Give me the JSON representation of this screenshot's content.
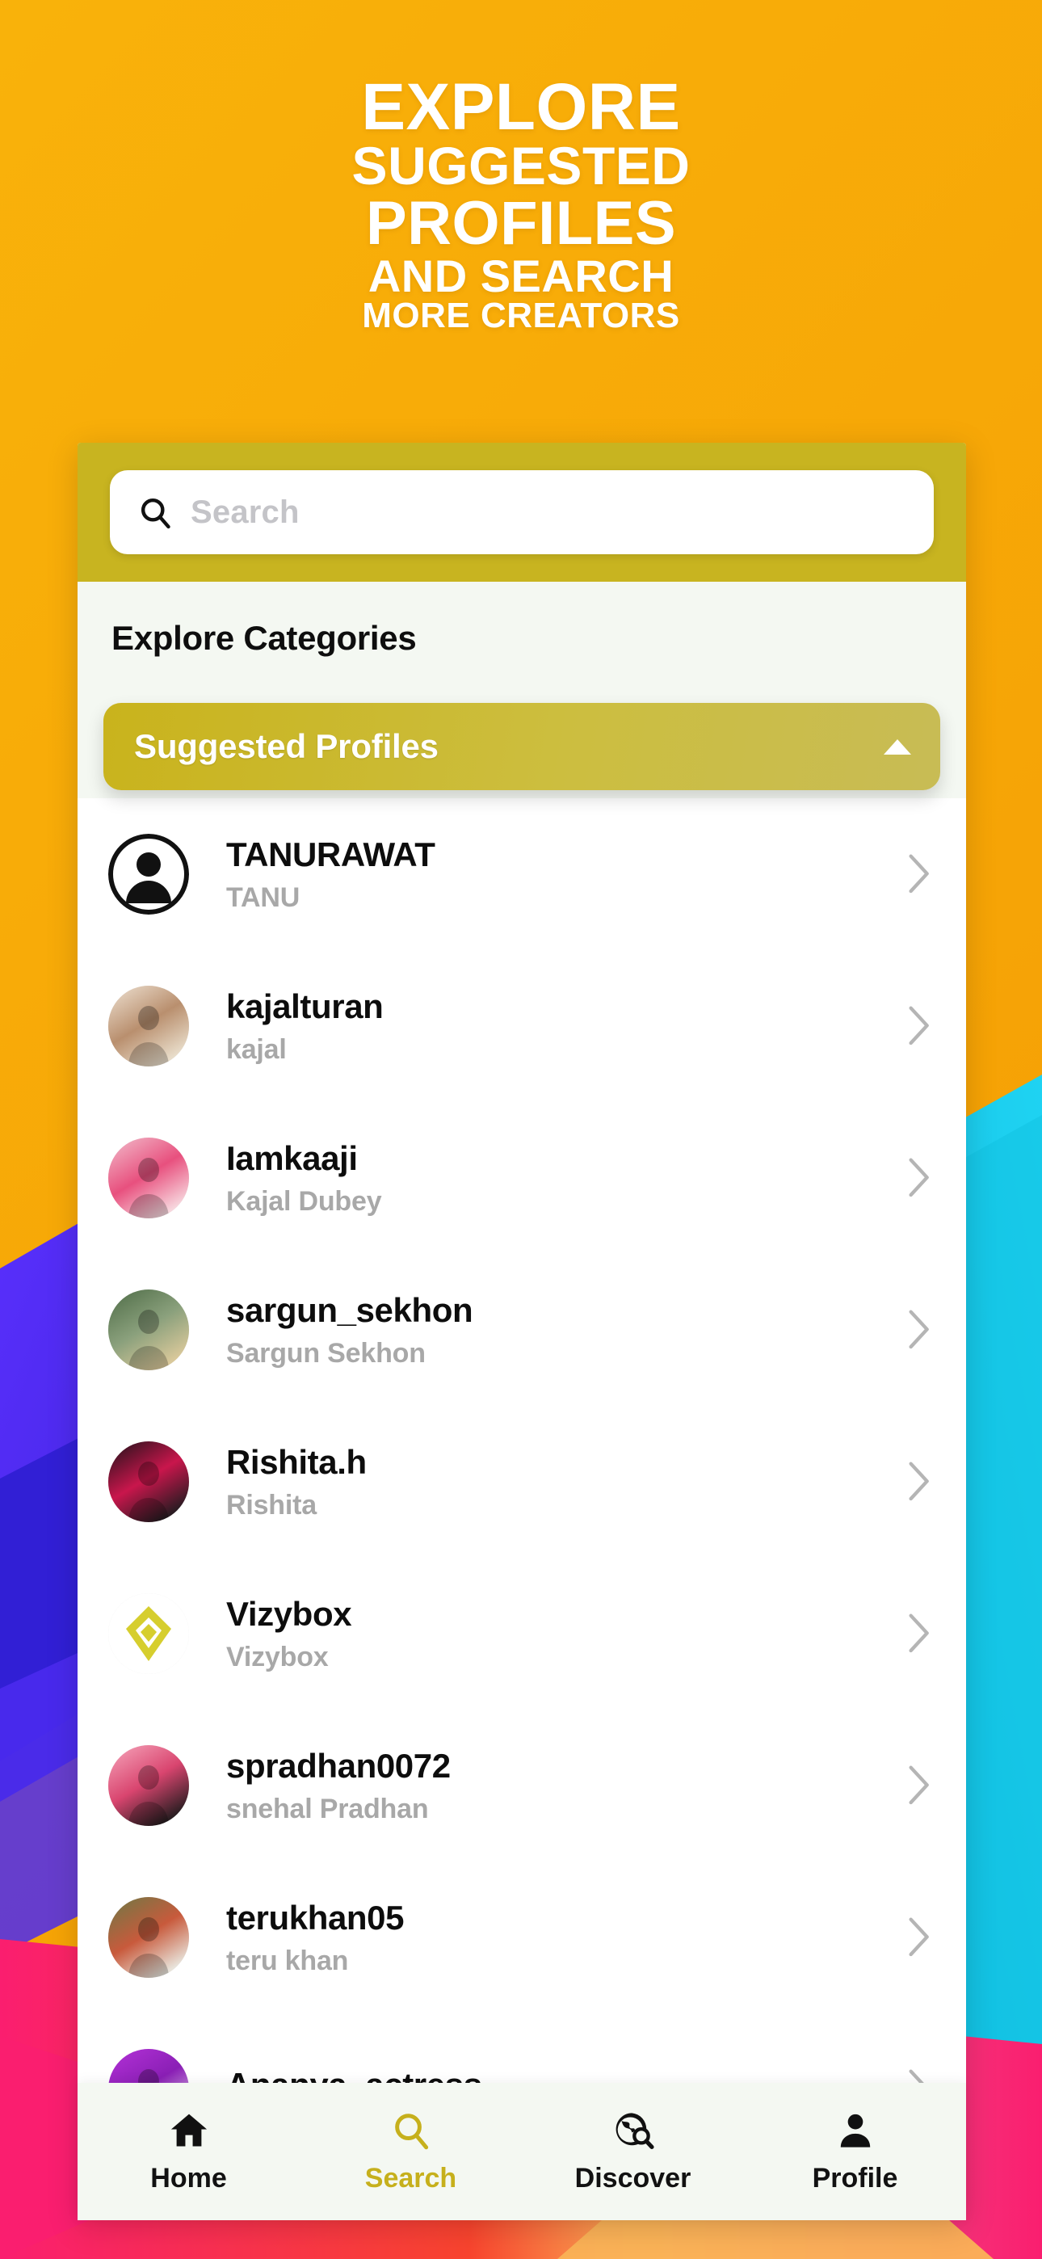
{
  "promo": {
    "line1": "EXPLORE",
    "line2": "SUGGESTED",
    "line3": "PROFILES",
    "line4": "AND SEARCH",
    "line5": "MORE CREATORS"
  },
  "search": {
    "placeholder": "Search",
    "value": "",
    "icon": "search-icon"
  },
  "main": {
    "section_title": "Explore Categories",
    "accordion": {
      "label": "Suggested Profiles",
      "expanded": true,
      "caret_icon": "chevron-up-icon"
    }
  },
  "profiles": [
    {
      "username": "TANURAWAT",
      "fullname": "TANU",
      "avatar": "default-person-avatar"
    },
    {
      "username": "kajalturan",
      "fullname": "kajal",
      "avatar": "photo-avatar"
    },
    {
      "username": "Iamkaaji",
      "fullname": "Kajal Dubey",
      "avatar": "photo-avatar"
    },
    {
      "username": "sargun_sekhon",
      "fullname": "Sargun Sekhon",
      "avatar": "photo-avatar"
    },
    {
      "username": "Rishita.h",
      "fullname": "Rishita",
      "avatar": "photo-avatar"
    },
    {
      "username": "Vizybox",
      "fullname": "Vizybox",
      "avatar": "vizybox-logo"
    },
    {
      "username": "spradhan0072",
      "fullname": "snehal Pradhan",
      "avatar": "photo-avatar"
    },
    {
      "username": "terukhan05",
      "fullname": "teru khan",
      "avatar": "photo-avatar"
    },
    {
      "username": "Ananya_actress",
      "fullname": "",
      "avatar": "photo-avatar"
    }
  ],
  "row_chevron_icon": "chevron-right-icon",
  "bottom_nav": [
    {
      "label": "Home",
      "icon": "home-icon",
      "active": false
    },
    {
      "label": "Search",
      "icon": "search-icon",
      "active": true
    },
    {
      "label": "Discover",
      "icon": "globe-search-icon",
      "active": false
    },
    {
      "label": "Profile",
      "icon": "person-icon",
      "active": false
    }
  ],
  "colors": {
    "background_orange": "#F7A806",
    "band_olive": "#C8B420",
    "accordion_gold": "#C9B31C",
    "accent_active": "#C6B01C",
    "card_bg": "#F4F8F2",
    "list_bg": "#FFFFFF",
    "username": "#0D0D0D",
    "fullname": "#A8A8A8",
    "blue_shape": "#4A2BF5",
    "cyan_shape": "#17C7E8",
    "pink_shape": "#F9246E"
  }
}
